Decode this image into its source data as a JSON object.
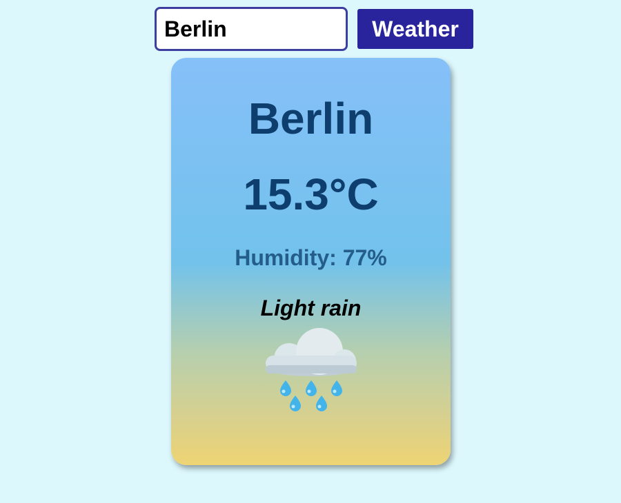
{
  "search": {
    "value": "Berlin",
    "button_label": "Weather"
  },
  "weather": {
    "city": "Berlin",
    "temperature": "15.3°C",
    "humidity": "Humidity: 77%",
    "description": "Light rain",
    "icon": "cloud-with-rain-icon"
  }
}
